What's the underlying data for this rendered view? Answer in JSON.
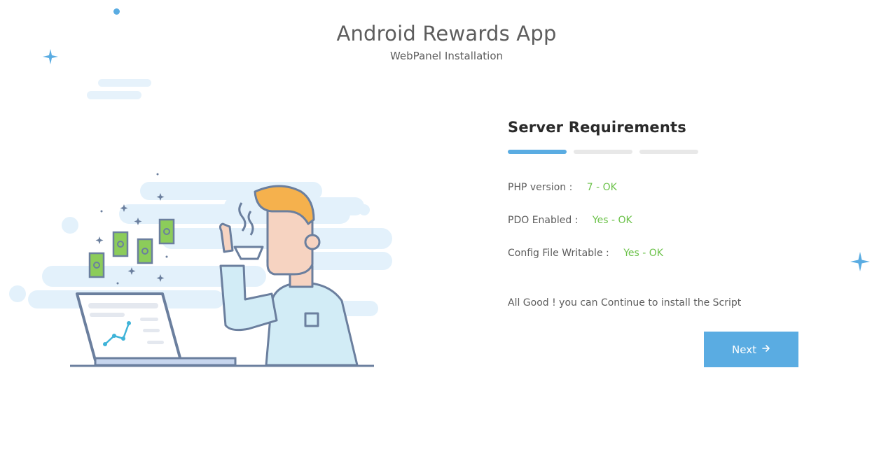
{
  "header": {
    "title": "Android Rewards App",
    "subtitle": "WebPanel Installation"
  },
  "panel": {
    "title": "Server Requirements",
    "steps": [
      {
        "state": "active"
      },
      {
        "state": "inactive"
      },
      {
        "state": "inactive"
      }
    ],
    "requirements": [
      {
        "label": "PHP version :",
        "status": "7 - OK"
      },
      {
        "label": "PDO Enabled :",
        "status": "Yes - OK"
      },
      {
        "label": "Config File Writable :",
        "status": "Yes - OK"
      }
    ],
    "message": "All Good ! you can Continue to install the Script"
  },
  "next_button": {
    "label": "Next",
    "icon": "arrow-right-icon"
  },
  "colors": {
    "accent": "#5aace2",
    "ok": "#6cc24a",
    "text": "#5d5d5d",
    "heading": "#2a2a2a"
  }
}
